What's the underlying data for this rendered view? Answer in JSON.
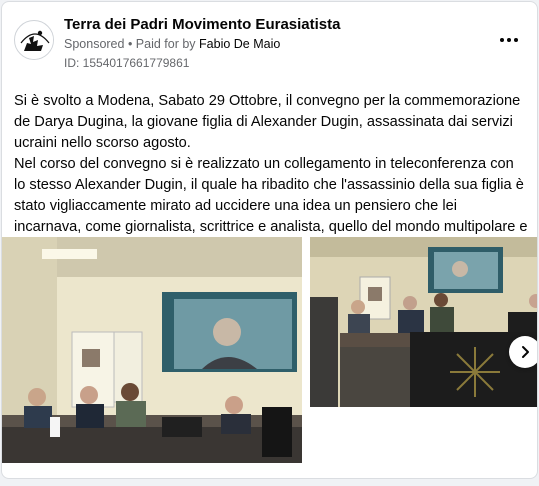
{
  "post": {
    "page_name": "Terra dei Padri Movimento Eurasiatista",
    "sponsored_label": "Sponsored",
    "separator": " • ",
    "paid_by_label": "Paid for by ",
    "payer_name": "Fabio De Maio",
    "ad_id": "ID: 1554017661779861",
    "paragraphs": [
      "Si è svolto a Modena, Sabato 29 Ottobre, il convegno per la commemorazione de Darya Dugina, la giovane figlia di Alexander Dugin, assassinata dai servizi ucraini nello scorso agosto.",
      "Nel corso del convegno si è realizzato un collegamento in teleconferenza con lo stesso Alexander Dugin, il quale ha ribadito che l'assassinio della sua figlia è stato vigliaccamente mirato ad uccidere una idea un pensiero che lei incarnava, come giornalista, scrittrice e analista, quello del mondo multipolare e delle idee della…"
    ],
    "icons": {
      "more": "more-horizontal-icon",
      "next": "chevron-right-icon"
    }
  }
}
